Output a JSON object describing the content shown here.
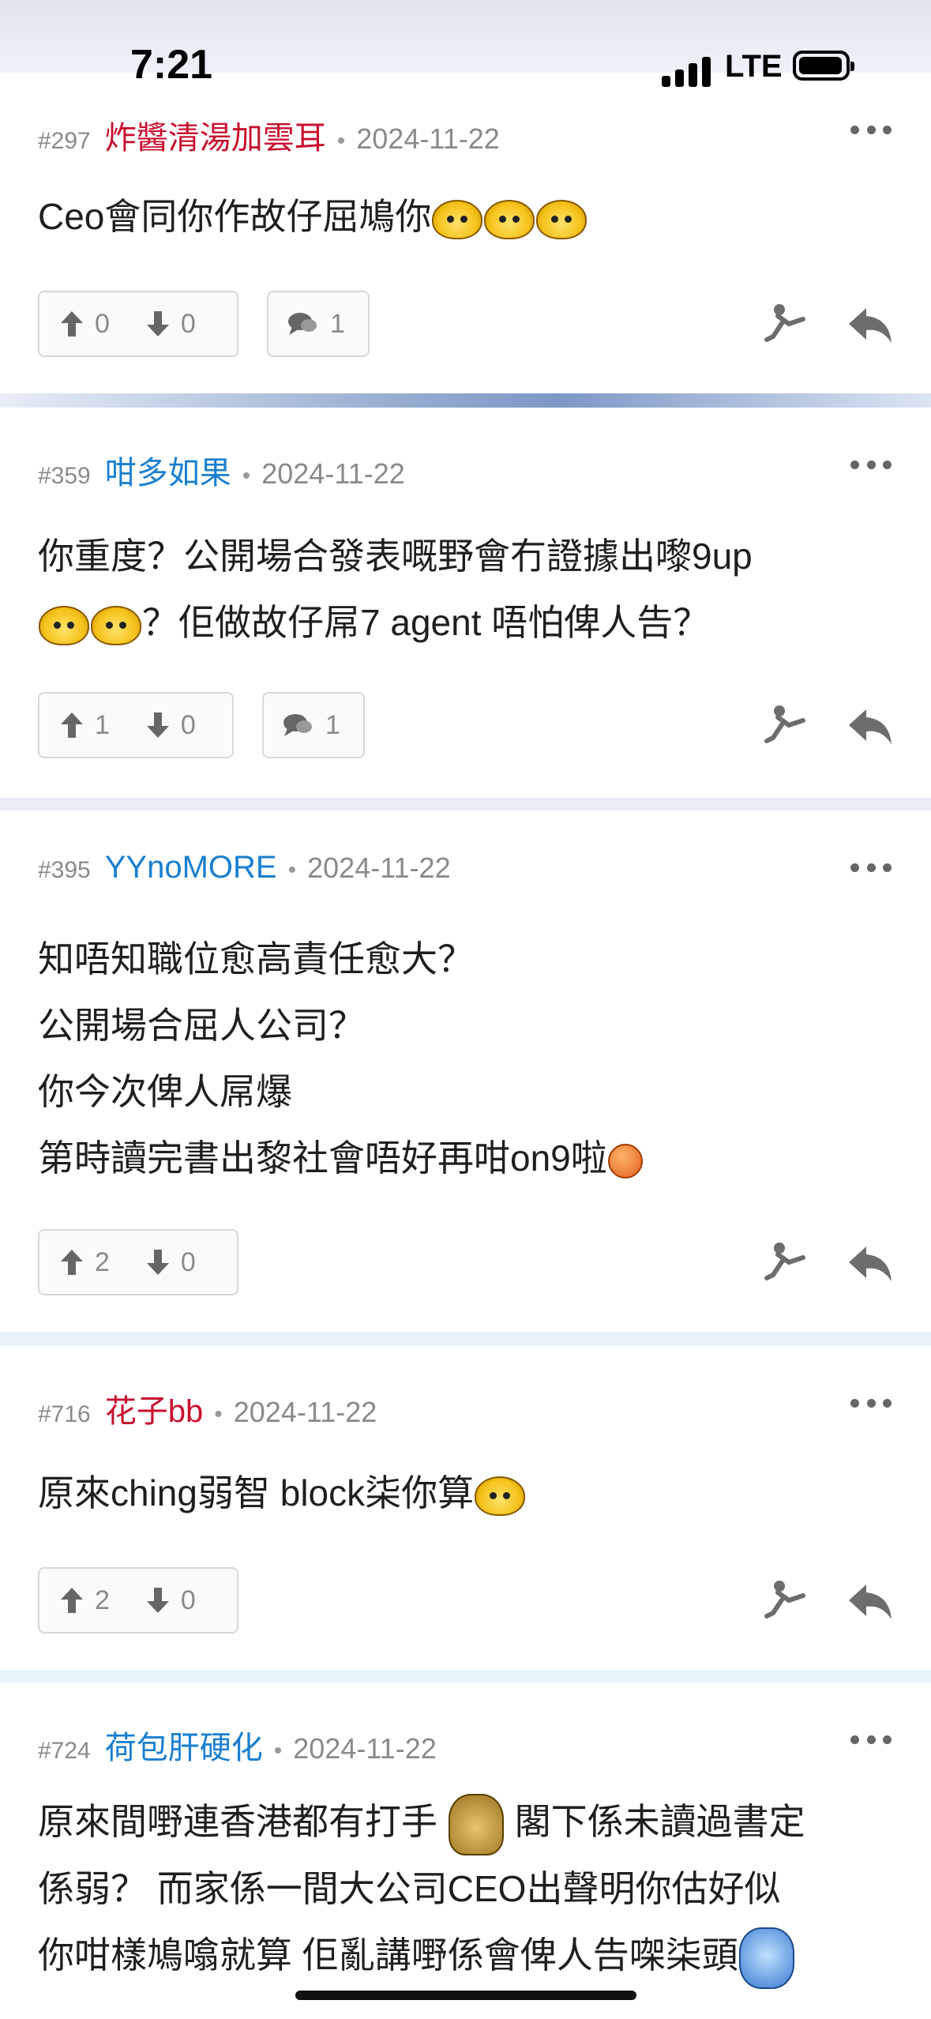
{
  "status_bar": {
    "time": "7:21",
    "network": "LTE"
  },
  "comments": [
    {
      "floor": "#297",
      "user": "炸醬清湯加雲耳",
      "user_color": "#c8102e",
      "separator": "•",
      "date": "2024-11-22",
      "lines": [
        "Ceo會同你作故仔屈鳩你"
      ],
      "emoticons": [
        "laugh-face-icon",
        "laugh-face-icon",
        "laugh-face-icon"
      ],
      "upvotes": "0",
      "downvotes": "0",
      "replies": "1"
    },
    {
      "floor": "#359",
      "user": "咁多如果",
      "user_color": "#1a7fd0",
      "separator": "•",
      "date": "2024-11-22",
      "lines": [
        "你重度？公開場合發表嘅野會冇證據出嚟9up",
        "？佢做故仔屌7 agent 唔怕俾人告？"
      ],
      "emoticons": [
        "laugh-face-icon",
        "laugh-face-icon"
      ],
      "upvotes": "1",
      "downvotes": "0",
      "replies": "1"
    },
    {
      "floor": "#395",
      "user": "YYnoMORE",
      "user_color": "#1a7fd0",
      "separator": "•",
      "date": "2024-11-22",
      "lines": [
        "知唔知職位愈高責任愈大？",
        "公開場合屈人公司？",
        "你今次俾人屌爆",
        "第時讀完書出黎社會唔好再咁on9啦"
      ],
      "emoticons": [
        "smirk-face-icon"
      ],
      "upvotes": "2",
      "downvotes": "0"
    },
    {
      "floor": "#716",
      "user": "花子bb",
      "user_color": "#c8102e",
      "separator": "•",
      "date": "2024-11-22",
      "lines": [
        "原來ching弱智 block柒你算"
      ],
      "emoticons": [
        "laugh-face-icon"
      ],
      "upvotes": "2",
      "downvotes": "0"
    },
    {
      "floor": "#724",
      "user": "荷包肝硬化",
      "user_color": "#1a7fd0",
      "separator": "•",
      "date": "2024-11-22",
      "lines": [
        "原來間嘢連香港都有打手",
        "閣下係未讀過書定",
        "係弱？ 而家係一間大公司CEO出聲明你估好似",
        "你咁樣鳩噏就算 佢亂講嘢係會俾人告㗎柒頭"
      ],
      "emoticons": [
        "shocked-face-icon",
        "blue-monster-icon"
      ]
    }
  ]
}
